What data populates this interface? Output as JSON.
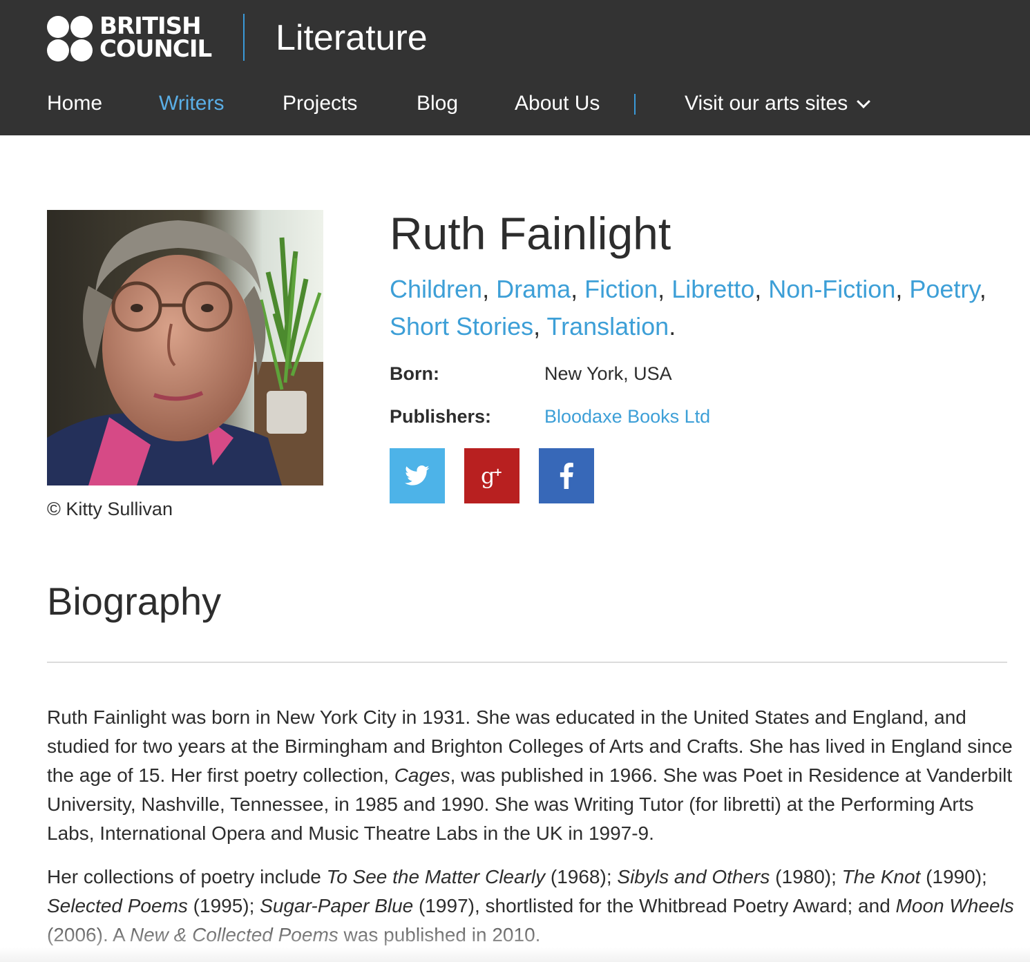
{
  "header": {
    "logo_line1": "BRITISH",
    "logo_line2": "COUNCIL",
    "section_title": "Literature",
    "accent_color": "#3a9ad9",
    "background_color": "#333333"
  },
  "nav": {
    "items": [
      {
        "label": "Home",
        "active": false
      },
      {
        "label": "Writers",
        "active": true
      },
      {
        "label": "Projects",
        "active": false
      },
      {
        "label": "Blog",
        "active": false
      },
      {
        "label": "About Us",
        "active": false
      }
    ],
    "arts_sites_label": "Visit our arts sites",
    "arts_sites_icon": "chevron-down-icon"
  },
  "profile": {
    "name": "Ruth Fainlight",
    "photo_credit": "©  Kitty Sullivan",
    "genres": [
      "Children",
      "Drama",
      "Fiction",
      "Libretto",
      "Non-Fiction",
      "Poetry",
      "Short Stories",
      "Translation"
    ],
    "genre_separator": ", ",
    "genre_end": ".",
    "born_label": "Born:",
    "born_value": "New York, USA",
    "publishers_label": "Publishers:",
    "publishers_value": "Bloodaxe Books Ltd",
    "link_color": "#3d9fd7"
  },
  "share": {
    "buttons": [
      {
        "icon": "twitter-icon",
        "color": "#4db3e8"
      },
      {
        "icon": "google-plus-icon",
        "color": "#b82020",
        "glyph": "g+"
      },
      {
        "icon": "facebook-icon",
        "color": "#3768b8",
        "glyph": "f"
      }
    ]
  },
  "biography": {
    "heading": "Biography",
    "p1": [
      {
        "text": "Ruth Fainlight was born in New York City in 1931. She was educated in the United States and England, and studied for two years at the Birmingham and Brighton Colleges of Arts and Crafts. She has lived in England since the age of 15. Her first poetry collection, ",
        "em": false
      },
      {
        "text": "Cages",
        "em": true
      },
      {
        "text": ", was published in 1966. She was Poet in Residence at Vanderbilt University, Nashville, Tennessee, in 1985 and 1990. She was Writing Tutor (for libretti) at the Performing Arts Labs, International Opera and Music Theatre Labs in the UK in 1997-9.",
        "em": false
      }
    ],
    "p2": [
      {
        "text": "Her collections of poetry include ",
        "em": false
      },
      {
        "text": "To See the Matter Clearly",
        "em": true
      },
      {
        "text": " (1968); ",
        "em": false
      },
      {
        "text": "Sibyls and Others",
        "em": true
      },
      {
        "text": " (1980); ",
        "em": false
      },
      {
        "text": "The Knot",
        "em": true
      },
      {
        "text": " (1990); ",
        "em": false
      },
      {
        "text": "Selected Poems",
        "em": true
      },
      {
        "text": " (1995); ",
        "em": false
      },
      {
        "text": "Sugar-Paper Blue",
        "em": true
      },
      {
        "text": " (1997), shortlisted for the Whitbread Poetry Award; and ",
        "em": false
      },
      {
        "text": "Moon Wheels",
        "em": true
      },
      {
        "text": " (2006). A ",
        "em": false
      },
      {
        "text": "New & Collected Poems",
        "em": true
      },
      {
        "text": " was published in 2010.",
        "em": false
      }
    ]
  }
}
